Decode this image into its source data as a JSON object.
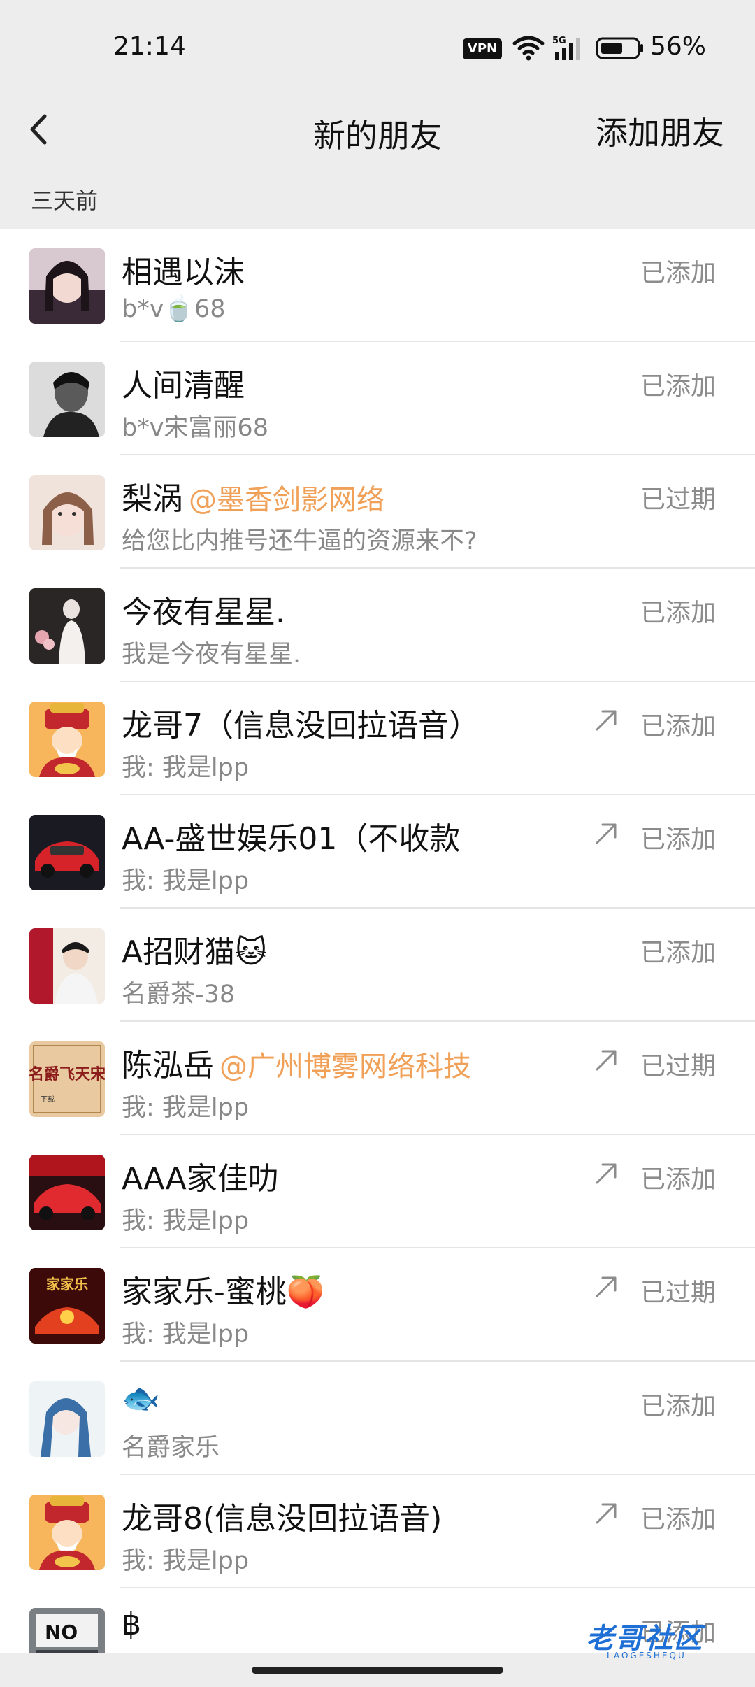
{
  "status_bar": {
    "time": "21:14",
    "vpn": "VPN",
    "network": "5G",
    "battery": "56%"
  },
  "nav": {
    "title": "新的朋友",
    "add_friend": "添加朋友"
  },
  "section": {
    "label": "三天前"
  },
  "rows": [
    {
      "name": "相遇以沫",
      "org": "",
      "sub": "b*v🍵68",
      "status": "已添加",
      "share": false,
      "avatar": "girl-portrait"
    },
    {
      "name": "人间清醒",
      "org": "",
      "sub": "b*v宋富丽68",
      "status": "已添加",
      "share": false,
      "avatar": "bw-man"
    },
    {
      "name": "梨涡",
      "org": "@墨香剑影网络",
      "sub": "给您比内推号还牛逼的资源来不?",
      "status": "已过期",
      "share": false,
      "avatar": "girl-selfie"
    },
    {
      "name": "今夜有星星.",
      "org": "",
      "sub": "我是今夜有星星.",
      "status": "已添加",
      "share": false,
      "avatar": "girl-white-dress"
    },
    {
      "name": "龙哥7（信息没回拉语音）",
      "org": "",
      "sub": "我: 我是lpp",
      "status": "已添加",
      "share": true,
      "avatar": "fortune-god"
    },
    {
      "name": "AA-盛世娱乐01（不收款",
      "org": "",
      "sub": "我: 我是lpp",
      "status": "已添加",
      "share": true,
      "avatar": "red-car"
    },
    {
      "name": "A招财猫🐱",
      "org": "",
      "sub": "名爵茶-38",
      "status": "已添加",
      "share": false,
      "avatar": "man-red"
    },
    {
      "name": "陈泓岳",
      "org": "@广州博雾网络科技",
      "sub": "我: 我是lpp",
      "status": "已过期",
      "share": true,
      "avatar": "calligraphy"
    },
    {
      "name": "AAA家佳叻",
      "org": "",
      "sub": "我: 我是lpp",
      "status": "已添加",
      "share": true,
      "avatar": "red-car-2"
    },
    {
      "name": "家家乐-蜜桃🍑",
      "org": "",
      "sub": "我: 我是lpp",
      "status": "已过期",
      "share": true,
      "avatar": "jiajiale"
    },
    {
      "name": "🐟",
      "org": "",
      "sub": "名爵家乐",
      "status": "已添加",
      "share": false,
      "avatar": "girl-blue"
    },
    {
      "name": "龙哥8(信息没回拉语音)",
      "org": "",
      "sub": "我: 我是lpp",
      "status": "已添加",
      "share": true,
      "avatar": "fortune-god"
    },
    {
      "name": "฿",
      "org": "",
      "sub": "",
      "status": "已添加",
      "share": false,
      "avatar": "no-sign"
    }
  ],
  "watermark": {
    "main": "老哥社区",
    "sub": "LAOGESHEQU"
  }
}
